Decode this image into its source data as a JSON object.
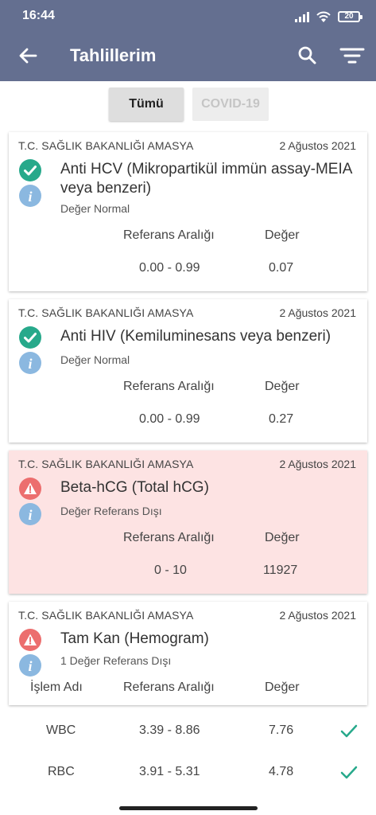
{
  "status_bar": {
    "time": "16:44",
    "battery": "20"
  },
  "app_bar": {
    "title": "Tahlillerim",
    "back_icon": "arrow-left-icon",
    "search_icon": "search-icon",
    "filter_icon": "filter-icon"
  },
  "tabs": [
    {
      "label": "Tümü",
      "selected": true
    },
    {
      "label": "COVID-19",
      "selected": false
    }
  ],
  "colors": {
    "header": "#646f90",
    "ok": "#27a98b",
    "alert": "#ec6e6e",
    "info": "#8bb8e0",
    "alert_bg": "#fde3e3"
  },
  "results": [
    {
      "institution": "T.C. SAĞLIK BAKANLIĞI AMASYA",
      "date": "2 Ağustos 2021",
      "name": "Anti HCV (Mikropartikül immün assay-MEIA veya benzeri)",
      "status": "ok",
      "status_text": "Değer Normal",
      "ref_header": "Referans Aralığı",
      "value_header": "Değer",
      "reference": "0.00 - 0.99",
      "value": "0.07"
    },
    {
      "institution": "T.C. SAĞLIK BAKANLIĞI AMASYA",
      "date": "2 Ağustos 2021",
      "name": "Anti HIV (Kemiluminesans veya benzeri)",
      "status": "ok",
      "status_text": "Değer Normal",
      "ref_header": "Referans Aralığı",
      "value_header": "Değer",
      "reference": "0.00 - 0.99",
      "value": "0.27"
    },
    {
      "institution": "T.C. SAĞLIK BAKANLIĞI AMASYA",
      "date": "2 Ağustos 2021",
      "name": "Beta-hCG (Total hCG)",
      "status": "alert",
      "status_text": "Değer Referans Dışı",
      "ref_header": "Referans Aralığı",
      "value_header": "Değer",
      "reference": "0 - 10",
      "value": "11927"
    },
    {
      "institution": "T.C. SAĞLIK BAKANLIĞI AMASYA",
      "date": "2 Ağustos 2021",
      "name": "Tam Kan (Hemogram)",
      "status": "alert",
      "status_text": "1 Değer Referans Dışı",
      "name_header": "İşlem Adı",
      "ref_header": "Referans Aralığı",
      "value_header": "Değer",
      "rows": [
        {
          "name": "WBC",
          "reference": "3.39 - 8.86",
          "value": "7.76",
          "ok": true
        },
        {
          "name": "RBC",
          "reference": "3.91 - 5.31",
          "value": "4.78",
          "ok": true
        }
      ]
    }
  ]
}
